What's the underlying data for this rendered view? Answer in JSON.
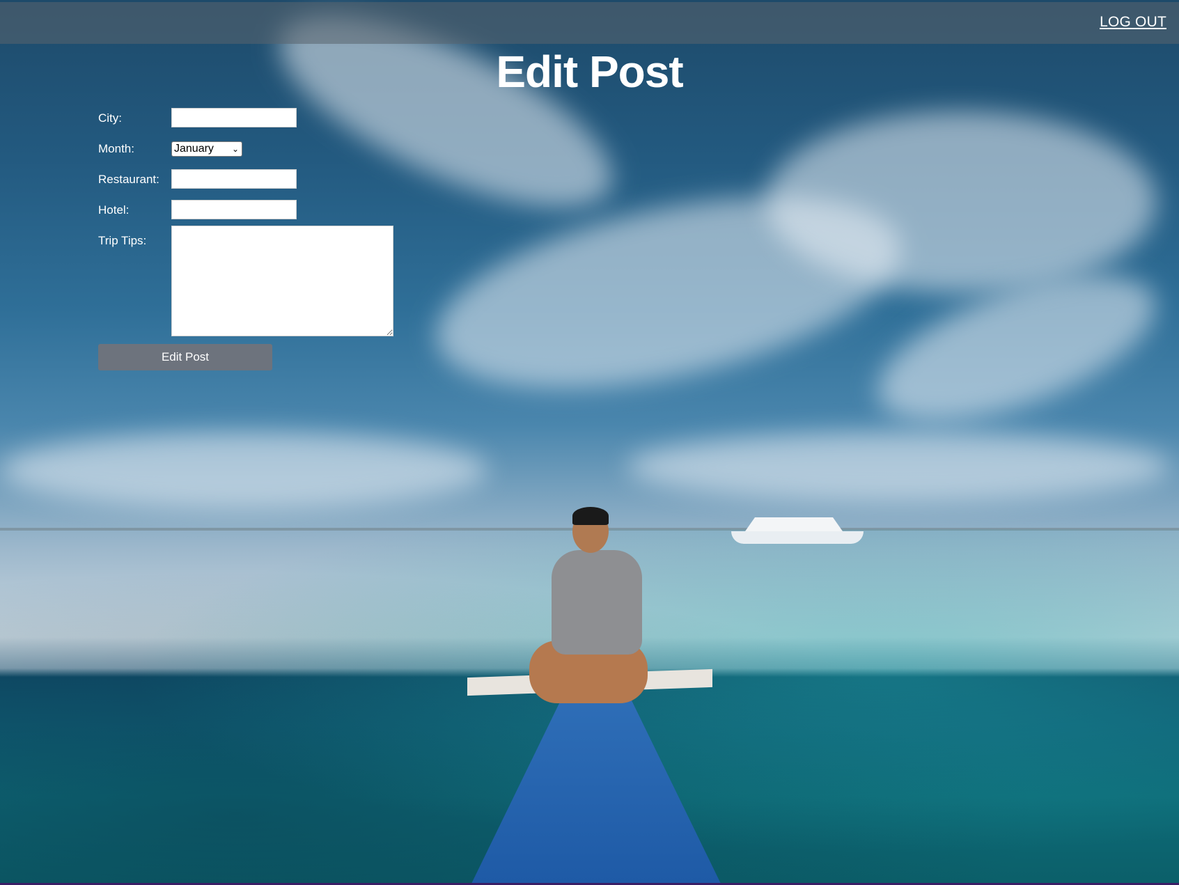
{
  "header": {
    "logout_label": "LOG OUT"
  },
  "page": {
    "title": "Edit Post"
  },
  "form": {
    "city": {
      "label": "City:",
      "value": ""
    },
    "month": {
      "label": "Month:",
      "value": "January"
    },
    "restaurant": {
      "label": "Restaurant:",
      "value": ""
    },
    "hotel": {
      "label": "Hotel:",
      "value": ""
    },
    "trip_tips": {
      "label": "Trip Tips:",
      "value": ""
    },
    "submit_label": "Edit Post"
  },
  "icons": {
    "month_dropdown": "chevron-down-icon"
  }
}
